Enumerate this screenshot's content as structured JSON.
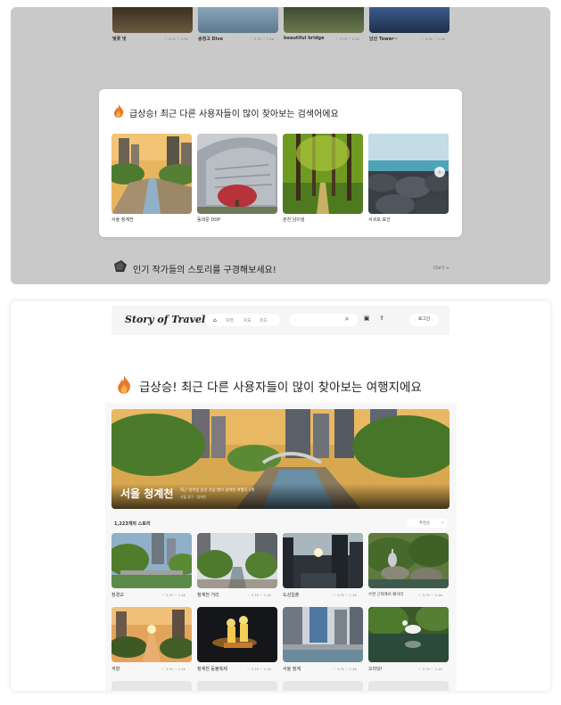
{
  "top_panel": {
    "strip_items": [
      {
        "label": "벚꽃 벗",
        "stats": "♡ 3.7k  ♡ 1.4k"
      },
      {
        "label": "송정고 Dive",
        "stats": "♡ 3.7k  ♡ 1.4k"
      },
      {
        "label": "beautiful bridge",
        "stats": "♡ 3.7k  ♡ 1.4k"
      },
      {
        "label": "남산 Tower~",
        "stats": "♡ 3.7k  ♡ 1.4k"
      }
    ],
    "popup": {
      "title": "급상승! 최근 다른 사용자들이 많이 찾아보는 검색어에요",
      "items": [
        {
          "label": "서울 청계천"
        },
        {
          "label": "동대문 DDP"
        },
        {
          "label": "춘천 남이섬"
        },
        {
          "label": "서귀포 표선"
        }
      ],
      "next_icon": "›"
    },
    "section_title": "인기 작가들의 스토리를 구경해보세요!",
    "more_link": "더보기 >"
  },
  "navbar": {
    "logo": "Story of Travel",
    "tabs": [
      "지역",
      "지도",
      "피드"
    ],
    "login": "로그인",
    "icons": {
      "search": "⌕",
      "gallery": "▣",
      "upload": "⇪"
    }
  },
  "main": {
    "title": "급상승! 최근 다른 사용자들이 많이 찾아보는 여행지에요",
    "hero": {
      "title": "서울 청계천",
      "description": "최근 일주일 동안 가장 많이 검색된 여행지 1위",
      "subtitle": "서울 중구 · 청계천"
    },
    "story_count": "1,223개의 스토리",
    "sort": {
      "selected": "추천순"
    },
    "grid": [
      {
        "label": "창경교",
        "stats": "♡ 3.7k  ♡ 1.4k"
      },
      {
        "label": "청계천 거리",
        "stats": "♡ 3.7k  ♡ 1.4k"
      },
      {
        "label": "도심일출",
        "stats": "♡ 3.7k  ♡ 1.4k"
      },
      {
        "label": "수면 근처에서 왜가리",
        "stats": "♡ 3.7k  ♡ 1.4k"
      },
      {
        "label": "석양",
        "stats": "♡ 3.7k  ♡ 1.4k"
      },
      {
        "label": "청계천 등불축제",
        "stats": "♡ 3.7k  ♡ 1.4k"
      },
      {
        "label": "서울 청계",
        "stats": "♡ 3.7k  ♡ 1.4k"
      },
      {
        "label": "오리닷!",
        "stats": "♡ 3.7k  ♡ 1.4k"
      }
    ]
  },
  "colors": {
    "flame": "#e8772e",
    "panel_gray": "#c9c9c9",
    "accent_dark": "#222222"
  }
}
